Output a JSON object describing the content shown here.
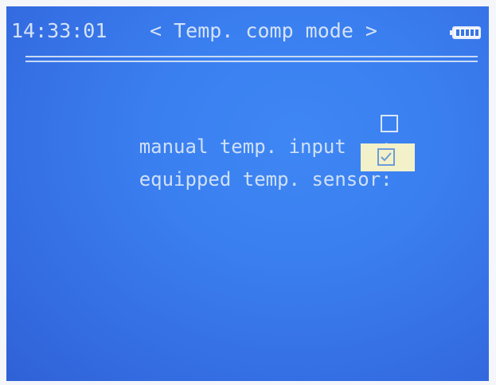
{
  "header": {
    "time": "14:33:01",
    "mode_title": "< Temp. comp mode >"
  },
  "battery": {
    "level": 1.0
  },
  "options": [
    {
      "label": "manual temp. input   :",
      "checked": false
    },
    {
      "label": "equipped temp. sensor:",
      "checked": true
    }
  ]
}
